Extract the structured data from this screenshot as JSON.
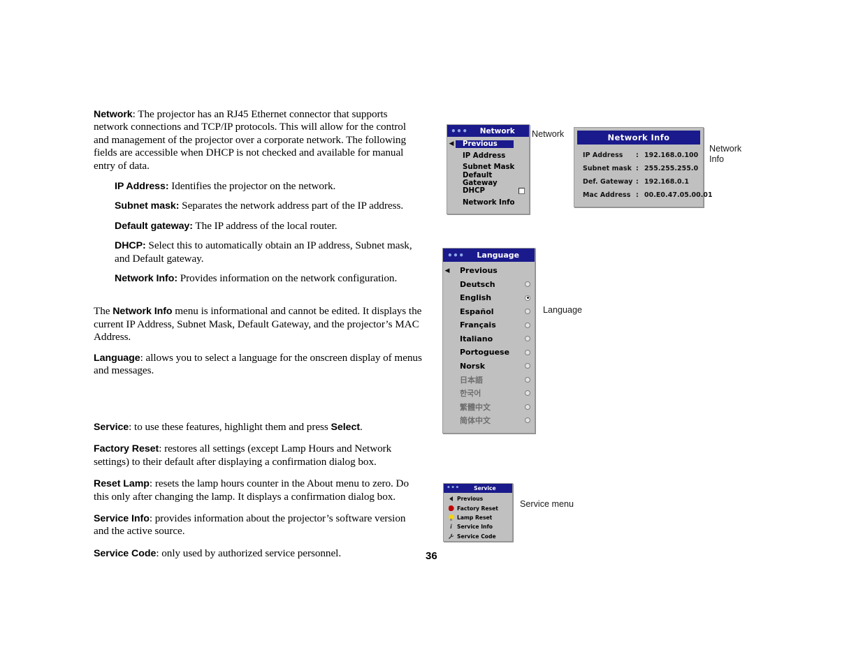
{
  "page": {
    "number": "36"
  },
  "body_text": {
    "paragraphs": [
      {
        "id": "network",
        "term": "Network",
        "rest": ": The projector has an RJ45 Ethernet connector that supports network connections and TCP/IP protocols. This will allow for the control and management of the projector over a corporate network. The following fields are accessible when DHCP is not checked and available for manual entry of data."
      },
      {
        "id": "ip-address",
        "term": "IP Address:",
        "rest": " Identifies the projector on the network."
      },
      {
        "id": "subnet-mask",
        "term": "Subnet mask:",
        "rest": " Separates the network address part of the IP address."
      },
      {
        "id": "default-gateway",
        "term": "Default gateway:",
        "rest": " The IP address of the local router."
      },
      {
        "id": "dhcp",
        "term": "DHCP:",
        "rest": " Select this to automatically obtain an IP address, Subnet mask, and Default gateway."
      },
      {
        "id": "network-info",
        "term": "Network Info:",
        "rest": " Provides information on the network configuration."
      }
    ],
    "network_info_para": {
      "lead": "The ",
      "term": "Network Info",
      "rest": " menu is informational and cannot be edited. It displays the current IP Address, Subnet Mask, Default Gateway, and the projector’s MAC Address."
    },
    "language_para": {
      "term": "Language",
      "rest": ": allows you to select a language for the onscreen display of menus and messages."
    },
    "service_paragraphs": [
      {
        "id": "service",
        "term": "Service",
        "rest": ": to use these features, highlight them and press ",
        "term2": "Select",
        "rest2": "."
      },
      {
        "id": "factory-reset",
        "term": "Factory Reset",
        "rest": ": restores all settings (except Lamp Hours and Network settings) to their default after displaying a confirmation dialog box."
      },
      {
        "id": "reset-lamp",
        "term": "Reset Lamp",
        "rest": ": resets the lamp hours counter in the About menu to zero. Do this only after changing the lamp. It displays a confirmation dialog box."
      },
      {
        "id": "service-info",
        "term": "Service Info",
        "rest": ": provides information about the projector’s software version and the active source."
      },
      {
        "id": "service-code",
        "term": "Service Code",
        "rest": ": only used by authorized service personnel."
      }
    ]
  },
  "network_menu": {
    "dots": "•••",
    "title": "Network",
    "items": [
      {
        "label": "Previous",
        "highlighted": true,
        "arrow": "◀"
      },
      {
        "label": "IP Address",
        "highlighted": false
      },
      {
        "label": "Subnet Mask",
        "highlighted": false
      },
      {
        "label": "Default Gateway",
        "highlighted": false
      },
      {
        "label": "DHCP",
        "highlighted": false,
        "checkbox": false
      },
      {
        "label": "Network Info",
        "highlighted": false
      }
    ]
  },
  "network_info_panel": {
    "title": "Network Info",
    "rows": [
      {
        "key": "IP  Address",
        "colon": ":",
        "value": "192.168.0.100"
      },
      {
        "key": "Subnet mask",
        "colon": ":",
        "value": "255.255.255.0"
      },
      {
        "key": "Def. Gateway",
        "colon": ":",
        "value": "192.168.0.1"
      },
      {
        "key": "Mac Address",
        "colon": ":",
        "value": "00.E0.47.05.00.01"
      }
    ]
  },
  "language_menu": {
    "dots": "•••",
    "title": "Language",
    "items": [
      {
        "label": "Previous",
        "arrow": "◀",
        "radio": false
      },
      {
        "label": "Deutsch",
        "radio": true,
        "selected": false
      },
      {
        "label": "English",
        "radio": true,
        "selected": true
      },
      {
        "label": "Español",
        "radio": true,
        "selected": false
      },
      {
        "label": "Français",
        "radio": true,
        "selected": false
      },
      {
        "label": "Italiano",
        "radio": true,
        "selected": false
      },
      {
        "label": "Portoguese",
        "radio": true,
        "selected": false
      },
      {
        "label": "Norsk",
        "radio": true,
        "selected": false
      },
      {
        "label": "日本語",
        "radio": true,
        "selected": false,
        "dim": true
      },
      {
        "label": "한국어",
        "radio": true,
        "selected": false,
        "dim": true
      },
      {
        "label": "繁體中文",
        "radio": true,
        "selected": false,
        "dim": true
      },
      {
        "label": "简体中文",
        "radio": true,
        "selected": false,
        "dim": true
      }
    ]
  },
  "service_menu": {
    "dots": "•••",
    "title": "Service",
    "items": [
      {
        "label": "Previous",
        "icon": "left-arrow-icon"
      },
      {
        "label": "Factory Reset",
        "icon": "red-octagon-icon"
      },
      {
        "label": "Lamp Reset",
        "icon": "lightbulb-icon"
      },
      {
        "label": "Service Info",
        "icon": "info-icon"
      },
      {
        "label": "Service Code",
        "icon": "wrench-icon"
      }
    ]
  },
  "callouts": {
    "network": "Network",
    "network_info": "Network\nInfo",
    "language": "Language",
    "service": "Service menu"
  },
  "colors": {
    "osd_title_bg": "#1a1a8c",
    "osd_body_bg": "#c0c0c0",
    "osd_highlight": "#1a1a8c",
    "dots": "#8fa8e8",
    "factory_reset_icon": "#c00000",
    "lamp_icon": "#f2d41a"
  }
}
